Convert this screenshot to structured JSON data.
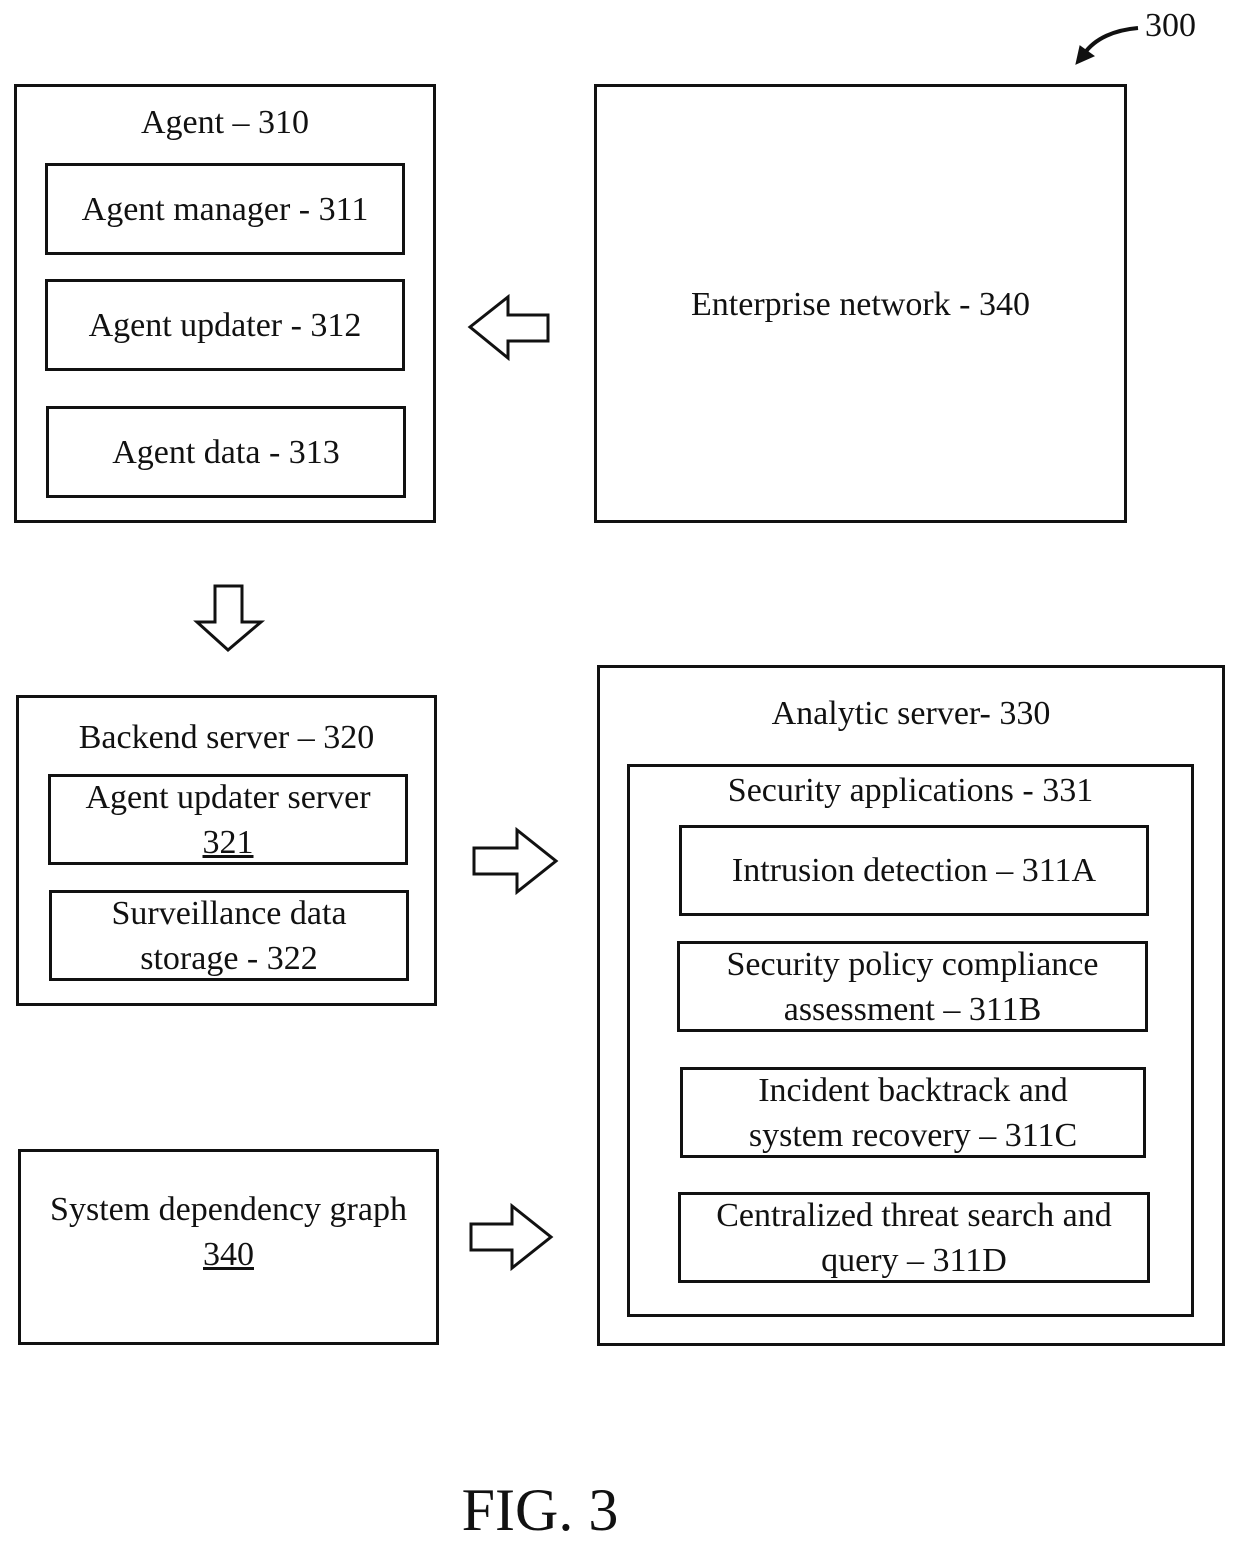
{
  "figure": {
    "reference_number": "300",
    "caption": "FIG. 3"
  },
  "agent": {
    "title": "Agent – 310",
    "items": [
      {
        "label": "Agent manager - 311"
      },
      {
        "label": "Agent updater - 312"
      },
      {
        "label": "Agent data - 313"
      }
    ]
  },
  "enterprise_network": {
    "label": "Enterprise network - 340"
  },
  "backend_server": {
    "title": "Backend server – 320",
    "items": [
      {
        "label": "Agent updater server",
        "ref": "321"
      },
      {
        "label": "Surveillance data",
        "label2": "storage - 322"
      }
    ]
  },
  "system_dependency_graph": {
    "label": "System dependency graph",
    "ref": "340"
  },
  "analytic_server": {
    "title": "Analytic server- 330",
    "security_applications": {
      "title": "Security applications - 331",
      "items": [
        {
          "line1": "Intrusion detection – 311A"
        },
        {
          "line1": "Security policy compliance",
          "line2": "assessment – 311B"
        },
        {
          "line1": "Incident backtrack and",
          "line2": "system recovery – 311C"
        },
        {
          "line1": "Centralized threat search and",
          "line2": "query – 311D"
        }
      ]
    }
  },
  "arrows": [
    {
      "from": "enterprise_network",
      "to": "agent",
      "direction": "left"
    },
    {
      "from": "agent",
      "to": "backend_server",
      "direction": "down"
    },
    {
      "from": "backend_server",
      "to": "analytic_server",
      "direction": "right"
    },
    {
      "from": "system_dependency_graph",
      "to": "analytic_server",
      "direction": "right"
    }
  ]
}
